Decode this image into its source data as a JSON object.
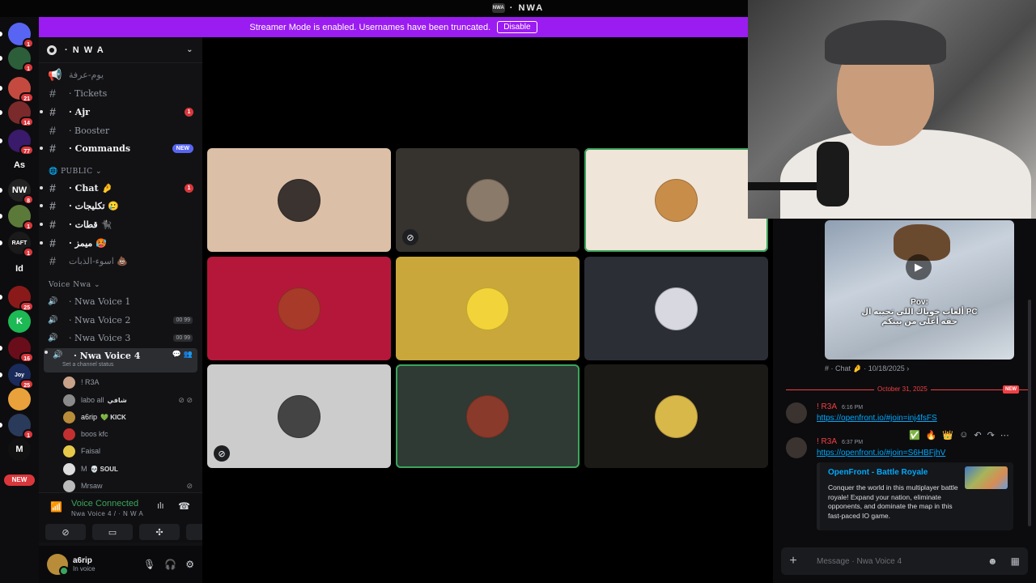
{
  "window": {
    "title": "· NWA",
    "server_mini": "NWA"
  },
  "banner": {
    "text": "Streamer Mode is enabled. Usernames have been truncated.",
    "button": "Disable"
  },
  "rail": {
    "items": [
      {
        "label": "",
        "color": "#5865f2",
        "badge": "1",
        "icon": "discord-icon"
      },
      {
        "label": "",
        "color": "#2c5e3a",
        "badge": "1"
      },
      {
        "label": "",
        "color": "#c44a3f",
        "badge": "21"
      },
      {
        "label": "",
        "color": "#7a2a2a",
        "badge": "14"
      },
      {
        "label": "",
        "color": "#3a1a6a",
        "badge": "77"
      },
      {
        "label": "As",
        "color": "#0d0d0f",
        "badge": ""
      },
      {
        "label": "NW",
        "color": "#222",
        "badge": "8"
      },
      {
        "label": "",
        "color": "#5b7a3a",
        "badge": "1"
      },
      {
        "label": "RAFT",
        "color": "#1a1a1a",
        "badge": "1"
      },
      {
        "label": "Id",
        "color": "#0d0d0f",
        "badge": ""
      },
      {
        "label": "",
        "color": "#8a1a1a",
        "badge": "25"
      },
      {
        "label": "K",
        "color": "#1db954",
        "badge": ""
      },
      {
        "label": "",
        "color": "#6a0d1a",
        "badge": "16"
      },
      {
        "label": "Joy",
        "color": "#1a2a5a",
        "badge": "25"
      },
      {
        "label": "",
        "color": "#e9a13b",
        "badge": ""
      },
      {
        "label": "",
        "color": "#2a3a5a",
        "badge": "1"
      },
      {
        "label": "M",
        "color": "#111",
        "badge": ""
      }
    ],
    "new_label": "NEW"
  },
  "sidebar": {
    "server_name": "· N W A",
    "channels": [
      {
        "name": "يوم-عرفة",
        "style": "muted",
        "icon": "announcement-icon",
        "badge": ""
      },
      {
        "name": "· Tickets",
        "style": "normal",
        "badge": ""
      },
      {
        "name": "· Ajr",
        "style": "unread",
        "badge": "1"
      },
      {
        "name": "· Booster",
        "style": "normal",
        "badge": ""
      },
      {
        "name": "· Commands",
        "style": "unread",
        "badge": "",
        "tag": "NEW"
      }
    ],
    "public_category": "PUBLIC",
    "public_channels": [
      {
        "name": "· Chat 🤌",
        "style": "unread",
        "badge": "1"
      },
      {
        "name": "· تكليجات 🥲",
        "style": "unread",
        "badge": ""
      },
      {
        "name": "· قطات 🐈‍⬛",
        "style": "unread",
        "badge": ""
      },
      {
        "name": "· ميمز 🥵",
        "style": "unread",
        "badge": ""
      },
      {
        "name": "اسوء-الذبات 💩",
        "style": "muted",
        "badge": ""
      }
    ],
    "voice_category": "Voice Nwa",
    "voice_channels": [
      {
        "name": "· Nwa Voice 1",
        "count": ""
      },
      {
        "name": "· Nwa Voice 2",
        "count": "00 99"
      },
      {
        "name": "· Nwa Voice 3",
        "count": "00 99"
      },
      {
        "name": "· Nwa Voice 4",
        "count": ""
      }
    ],
    "channel_status": "Set a channel status",
    "members": [
      {
        "name": "! R3A",
        "tag": "",
        "color": "#c9a28a"
      },
      {
        "name": "labo all",
        "tag": "شافي",
        "color": "#8a8a8a"
      },
      {
        "name": "a6rip",
        "tag": "💚 KICK",
        "color": "#b98c3a"
      },
      {
        "name": "boos kfc",
        "tag": "",
        "color": "#c43030"
      },
      {
        "name": "Faisal",
        "tag": "",
        "color": "#e6c94a"
      },
      {
        "name": "M",
        "tag": "💀 SOUL",
        "color": "#ddd"
      },
      {
        "name": "Mrsaw",
        "tag": "",
        "color": "#bbb"
      }
    ]
  },
  "voice_panel": {
    "status": "Voice Connected",
    "channel": "Nwa Voice 4 / · N W A"
  },
  "user_panel": {
    "name": "a6rip",
    "status": "In voice"
  },
  "tiles": [
    {
      "bg": "#dbbfa6",
      "avatar": "#3b3330",
      "speaking": false,
      "icon": ""
    },
    {
      "bg": "#36322e",
      "avatar": "#8a7a6a",
      "speaking": false,
      "icon": "video-off-icon"
    },
    {
      "bg": "#efe5d8",
      "avatar": "#c98d4a",
      "speaking": true,
      "icon": ""
    },
    {
      "bg": "#b5173a",
      "avatar": "#a83a2a",
      "speaking": false,
      "icon": ""
    },
    {
      "bg": "#c9a73a",
      "avatar": "#f2d33a",
      "speaking": false,
      "icon": ""
    },
    {
      "bg": "#2c2e36",
      "avatar": "#d8d8e0",
      "speaking": false,
      "icon": ""
    },
    {
      "bg": "#cccccc",
      "avatar": "#444",
      "speaking": false,
      "icon": "mic-off-icon"
    },
    {
      "bg": "#2e3a33",
      "avatar": "#8a3a2a",
      "speaking": true,
      "icon": ""
    },
    {
      "bg": "#1c1a17",
      "avatar": "#d9b84a",
      "speaking": false,
      "icon": ""
    }
  ],
  "chat": {
    "video_caption": "Pov:\nألعاب خوياك اللي تجيبه ال PC\nحقه أغلى من بيتكم",
    "forward_meta": "# · Chat 🤌 · 10/18/2025 ›",
    "divider_date": "October 31, 2025",
    "divider_new": "NEW",
    "messages": [
      {
        "author": "! R3A",
        "time": "6:16 PM",
        "link": "https://openfront.io/#join=inj4fsFS"
      },
      {
        "author": "! R3A",
        "time": "6:37 PM",
        "link": "https://openfront.io/#join=S6HBFjhV"
      }
    ],
    "embed": {
      "title": "OpenFront - Battle Royale",
      "description": "Conquer the world in this multiplayer battle royale! Expand your nation, eliminate opponents, and dominate the map in this fast-paced IO game."
    },
    "input_placeholder": "Message · Nwa Voice 4"
  }
}
